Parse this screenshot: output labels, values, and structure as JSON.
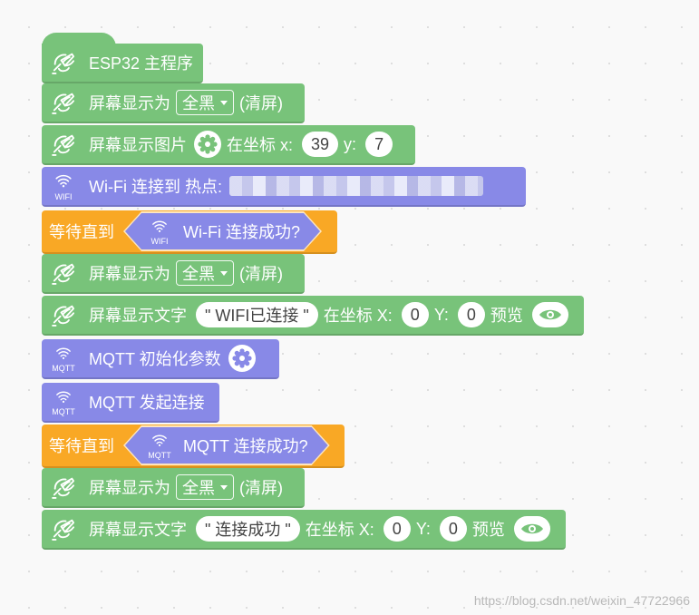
{
  "colors": {
    "green": "#78c37a",
    "purple": "#8889e7",
    "orange": "#f9a825"
  },
  "blocks": {
    "main": {
      "label": "ESP32 主程序",
      "icon": "oled-icon"
    },
    "clear1": {
      "label": "屏幕显示为",
      "dropdown": "全黑",
      "suffix": "(清屏)"
    },
    "image": {
      "label": "屏幕显示图片",
      "at": "在坐标 x:",
      "x": "39",
      "y_label": "y:",
      "y": "7"
    },
    "wifi_connect": {
      "label": "Wi-Fi 连接到 热点:",
      "icon_text": "WIFI"
    },
    "wait_wifi": {
      "label": "等待直到",
      "inner": "Wi-Fi 连接成功?",
      "icon_text": "WIFI"
    },
    "clear2": {
      "label": "屏幕显示为",
      "dropdown": "全黑",
      "suffix": "(清屏)"
    },
    "text1": {
      "label": "屏幕显示文字",
      "text": "\" WIFI已连接 \"",
      "at": "在坐标 X:",
      "x": "0",
      "y_label": "Y:",
      "y": "0",
      "preview": "预览"
    },
    "mqtt_init": {
      "label": "MQTT 初始化参数",
      "icon_text": "MQTT"
    },
    "mqtt_connect": {
      "label": "MQTT 发起连接",
      "icon_text": "MQTT"
    },
    "wait_mqtt": {
      "label": "等待直到",
      "inner": "MQTT 连接成功?",
      "icon_text": "MQTT"
    },
    "clear3": {
      "label": "屏幕显示为",
      "dropdown": "全黑",
      "suffix": "(清屏)"
    },
    "text2": {
      "label": "屏幕显示文字",
      "text": "\" 连接成功 \"",
      "at": "在坐标 X:",
      "x": "0",
      "y_label": "Y:",
      "y": "0",
      "preview": "预览"
    }
  },
  "watermark": "https://blog.csdn.net/weixin_47722966"
}
